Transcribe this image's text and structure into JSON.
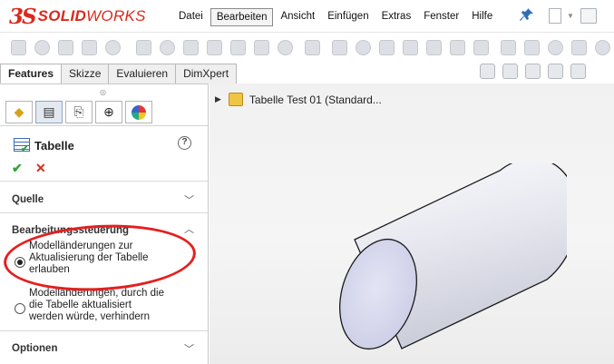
{
  "app": {
    "logo_mark": "3S",
    "logo_text_bold": "SOLID",
    "logo_text_rest": "WORKS"
  },
  "menu": {
    "items": [
      "Datei",
      "Bearbeiten",
      "Ansicht",
      "Einfügen",
      "Extras",
      "Fenster",
      "Hilfe"
    ],
    "active": "Bearbeiten"
  },
  "tabs": [
    "Features",
    "Skizze",
    "Evaluieren",
    "DimXpert"
  ],
  "active_tab": "Features",
  "property_manager": {
    "title": "Tabelle",
    "help_symbol": "?",
    "ok_symbol": "✔",
    "cancel_symbol": "✕",
    "sections": {
      "quelle": "Quelle",
      "bearbeitung": "Bearbeitungssteuerung",
      "optionen": "Optionen"
    },
    "options": [
      {
        "label_lines": [
          "Modelländerungen zur",
          "Aktualisierung der Tabelle",
          "erlauben"
        ],
        "selected": true
      },
      {
        "label_lines": [
          "Modelländerungen, durch die",
          "die Tabelle aktualisiert",
          "werden würde, verhindern"
        ],
        "selected": false
      }
    ]
  },
  "tree": {
    "item_label": "Tabelle Test 01  (Standard..."
  },
  "colors": {
    "brand_red": "#da291c",
    "annotation_red": "#e41f1f",
    "ok_green": "#2ea43a",
    "cancel_red": "#d22c1e"
  }
}
